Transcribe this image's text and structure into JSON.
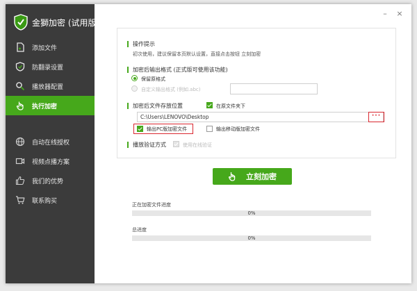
{
  "app": {
    "title": "金獅加密 (试用版)"
  },
  "titlebar": {
    "minimize": "–",
    "close": "×"
  },
  "sidebar": {
    "items": [
      {
        "label": "添加文件",
        "icon": "file-add-icon"
      },
      {
        "label": "防翻录设置",
        "icon": "shield-icon"
      },
      {
        "label": "播放器配置",
        "icon": "search-icon"
      },
      {
        "label": "执行加密",
        "icon": "hand-pointer-icon",
        "active": true
      }
    ],
    "bottom_items": [
      {
        "label": "自动在线授权",
        "icon": "globe-icon"
      },
      {
        "label": "视频点播方案",
        "icon": "video-icon"
      },
      {
        "label": "我们的优势",
        "icon": "thumbs-up-icon"
      },
      {
        "label": "联系购买",
        "icon": "cart-icon"
      }
    ]
  },
  "tips": {
    "title": "操作提示",
    "text": "初次使用，建议保留本页默认设置，直接点击按钮 立刻加密"
  },
  "format": {
    "title": "加密后输出格式 (正式版可使用该功能)",
    "option_keep": "保留原格式",
    "option_custom": "自定义输出格式 (例如.abc)",
    "custom_value": ""
  },
  "location": {
    "title": "加密后文件存放位置",
    "same_folder": "在原文件夹下",
    "path": "C:\\Users\\LENOVO\\Desktop",
    "browse": "···",
    "output_pc": "输出PC版加密文件",
    "output_mobile": "输出移动版加密文件"
  },
  "verify": {
    "title": "播放验证方式",
    "online": "使用在线验证"
  },
  "action": {
    "start": "立刻加密"
  },
  "progress": {
    "current_label": "正在加密文件进度",
    "current_value": "0%",
    "current_fraction": 0,
    "total_label": "总进度",
    "total_value": "0%",
    "total_fraction": 0
  },
  "colors": {
    "accent": "#46a81b",
    "sidebar": "#3b3b3b",
    "highlight": "#d9262e"
  }
}
